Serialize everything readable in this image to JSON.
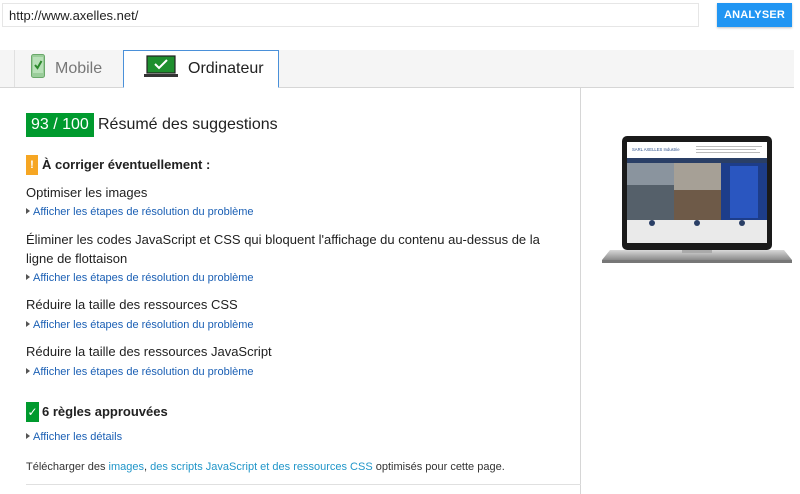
{
  "url_input": {
    "value": "http://www.axelles.net/"
  },
  "analyze_button": {
    "label": "ANALYSER"
  },
  "tabs": [
    {
      "label": "Mobile",
      "selected": false
    },
    {
      "label": "Ordinateur",
      "selected": true
    }
  ],
  "score": {
    "value": "93 / 100",
    "title": "Résumé des suggestions",
    "color": "#009a2e"
  },
  "warning_section": {
    "icon": "!",
    "title": "À corriger éventuellement :",
    "color": "#f6a623"
  },
  "rules": [
    {
      "title": "Optimiser les images",
      "link": "Afficher les étapes de résolution du problème"
    },
    {
      "title": "Éliminer les codes JavaScript et CSS qui bloquent l'affichage du contenu au-dessus de la ligne de flottaison",
      "link": "Afficher les étapes de résolution du problème"
    },
    {
      "title": "Réduire la taille des ressources CSS",
      "link": "Afficher les étapes de résolution du problème"
    },
    {
      "title": "Réduire la taille des ressources JavaScript",
      "link": "Afficher les étapes de résolution du problème"
    }
  ],
  "approved": {
    "icon": "✓",
    "title": "6 règles approuvées",
    "link": "Afficher les détails"
  },
  "footer": {
    "prefix": "Télécharger des ",
    "link_images": "images",
    "separator": ", ",
    "link_scripts": "des scripts JavaScript et des ressources CSS",
    "suffix": " optimisés pour cette page."
  },
  "preview": {
    "site_name": "SARL AXELLES Industrie"
  }
}
